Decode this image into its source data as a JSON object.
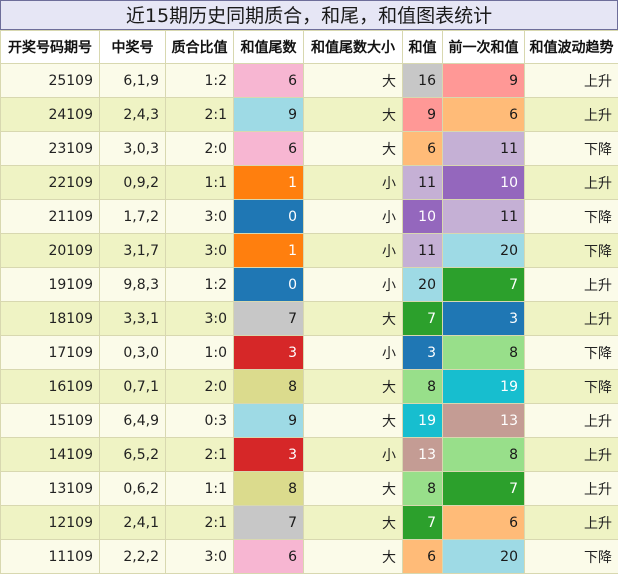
{
  "title": "近15期历史同期质合，和尾，和值图表统计",
  "headers": [
    "开奖号码期号",
    "中奖号",
    "质合比值",
    "和值尾数",
    "和值尾数大小",
    "和值",
    "前一次和值",
    "和值波动趋势"
  ],
  "rows": [
    {
      "period": "25109",
      "number": "6,1,9",
      "ratio": "1:2",
      "tail": "6",
      "size": "大",
      "sum": "16",
      "prev_sum": "9",
      "trend": "上升",
      "tail_color": "#f7b6d2",
      "sum_color": "#c7c7c7",
      "prev_color": "#ff9896"
    },
    {
      "period": "24109",
      "number": "2,4,3",
      "ratio": "2:1",
      "tail": "9",
      "size": "大",
      "sum": "9",
      "prev_sum": "6",
      "trend": "上升",
      "tail_color": "#9edae5",
      "sum_color": "#ff9896",
      "prev_color": "#ffbb78"
    },
    {
      "period": "23109",
      "number": "3,0,3",
      "ratio": "2:0",
      "tail": "6",
      "size": "大",
      "sum": "6",
      "prev_sum": "11",
      "trend": "下降",
      "tail_color": "#f7b6d2",
      "sum_color": "#ffbb78",
      "prev_color": "#c5b0d5"
    },
    {
      "period": "22109",
      "number": "0,9,2",
      "ratio": "1:1",
      "tail": "1",
      "size": "小",
      "sum": "11",
      "prev_sum": "10",
      "trend": "上升",
      "tail_color": "#ff7f0e",
      "sum_color": "#c5b0d5",
      "prev_color": "#9467bd"
    },
    {
      "period": "21109",
      "number": "1,7,2",
      "ratio": "3:0",
      "tail": "0",
      "size": "小",
      "sum": "10",
      "prev_sum": "11",
      "trend": "下降",
      "tail_color": "#1f77b4",
      "sum_color": "#9467bd",
      "prev_color": "#c5b0d5"
    },
    {
      "period": "20109",
      "number": "3,1,7",
      "ratio": "3:0",
      "tail": "1",
      "size": "小",
      "sum": "11",
      "prev_sum": "20",
      "trend": "下降",
      "tail_color": "#ff7f0e",
      "sum_color": "#c5b0d5",
      "prev_color": "#9edae5"
    },
    {
      "period": "19109",
      "number": "9,8,3",
      "ratio": "1:2",
      "tail": "0",
      "size": "小",
      "sum": "20",
      "prev_sum": "7",
      "trend": "上升",
      "tail_color": "#1f77b4",
      "sum_color": "#9edae5",
      "prev_color": "#2ca02c"
    },
    {
      "period": "18109",
      "number": "3,3,1",
      "ratio": "3:0",
      "tail": "7",
      "size": "大",
      "sum": "7",
      "prev_sum": "3",
      "trend": "上升",
      "tail_color": "#c7c7c7",
      "sum_color": "#2ca02c",
      "prev_color": "#1f77b4"
    },
    {
      "period": "17109",
      "number": "0,3,0",
      "ratio": "1:0",
      "tail": "3",
      "size": "小",
      "sum": "3",
      "prev_sum": "8",
      "trend": "下降",
      "tail_color": "#d62728",
      "sum_color": "#1f77b4",
      "prev_color": "#98df8a"
    },
    {
      "period": "16109",
      "number": "0,7,1",
      "ratio": "2:0",
      "tail": "8",
      "size": "大",
      "sum": "8",
      "prev_sum": "19",
      "trend": "下降",
      "tail_color": "#dbdb8d",
      "sum_color": "#98df8a",
      "prev_color": "#17becf"
    },
    {
      "period": "15109",
      "number": "6,4,9",
      "ratio": "0:3",
      "tail": "9",
      "size": "大",
      "sum": "19",
      "prev_sum": "13",
      "trend": "上升",
      "tail_color": "#9edae5",
      "sum_color": "#17becf",
      "prev_color": "#c49c94"
    },
    {
      "period": "14109",
      "number": "6,5,2",
      "ratio": "2:1",
      "tail": "3",
      "size": "小",
      "sum": "13",
      "prev_sum": "8",
      "trend": "上升",
      "tail_color": "#d62728",
      "sum_color": "#c49c94",
      "prev_color": "#98df8a"
    },
    {
      "period": "13109",
      "number": "0,6,2",
      "ratio": "1:1",
      "tail": "8",
      "size": "大",
      "sum": "8",
      "prev_sum": "7",
      "trend": "上升",
      "tail_color": "#dbdb8d",
      "sum_color": "#98df8a",
      "prev_color": "#2ca02c"
    },
    {
      "period": "12109",
      "number": "2,4,1",
      "ratio": "2:1",
      "tail": "7",
      "size": "大",
      "sum": "7",
      "prev_sum": "6",
      "trend": "上升",
      "tail_color": "#c7c7c7",
      "sum_color": "#2ca02c",
      "prev_color": "#ffbb78"
    },
    {
      "period": "11109",
      "number": "2,2,2",
      "ratio": "3:0",
      "tail": "6",
      "size": "大",
      "sum": "6",
      "prev_sum": "20",
      "trend": "下降",
      "tail_color": "#f7b6d2",
      "sum_color": "#ffbb78",
      "prev_color": "#9edae5"
    }
  ]
}
